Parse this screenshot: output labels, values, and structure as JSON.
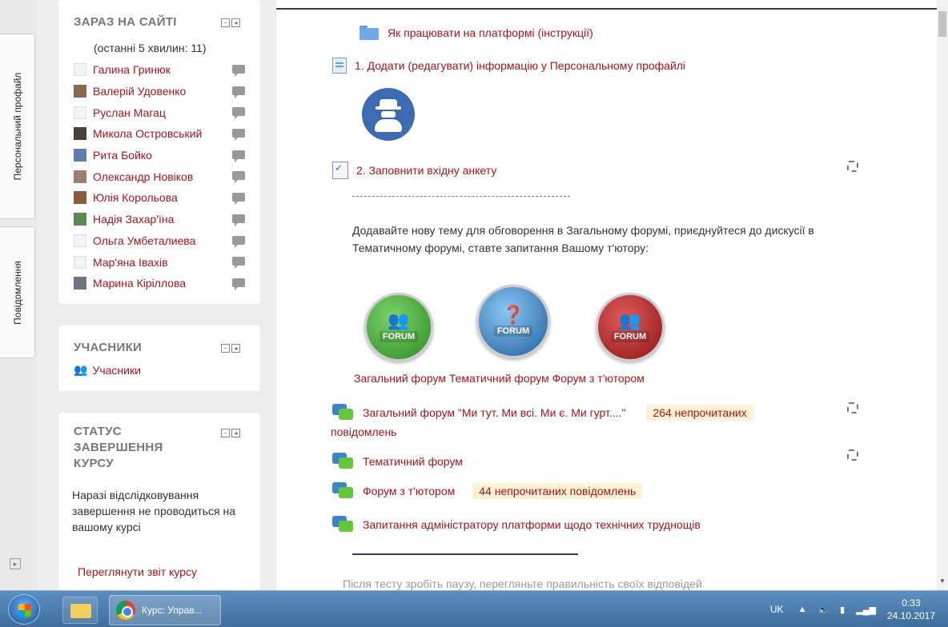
{
  "sidebar_tabs": {
    "profile": "Персональний профайл",
    "messages": "Повідомлення"
  },
  "online_block": {
    "title": "ЗАРАЗ НА САЙТІ",
    "subtitle": "(останні 5 хвилин: 11)",
    "users": [
      {
        "name": "Галина Гринюк",
        "has_photo": false
      },
      {
        "name": "Валерій Удовенко",
        "has_photo": true
      },
      {
        "name": "Руслан Магац",
        "has_photo": false
      },
      {
        "name": "Микола Островський",
        "has_photo": true
      },
      {
        "name": "Рита Бойко",
        "has_photo": true
      },
      {
        "name": "Олександр Новіков",
        "has_photo": true
      },
      {
        "name": "Юлія Корольова",
        "has_photo": true
      },
      {
        "name": "Надія Захар'їна",
        "has_photo": true
      },
      {
        "name": "Ольга Умбеталиева",
        "has_photo": false
      },
      {
        "name": "Мар'яна Івахів",
        "has_photo": false
      },
      {
        "name": "Марина Кіріллова",
        "has_photo": true
      }
    ]
  },
  "participants_block": {
    "title": "УЧАСНИКИ",
    "link": "Учасники"
  },
  "completion_block": {
    "title": "СТАТУС ЗАВЕРШЕННЯ КУРСУ",
    "text": "Наразі відслідковування завершення не проводиться на вашому курсі",
    "report_link": "Переглянути звіт курсу"
  },
  "main": {
    "instructions_folder": "Як працювати на платформі (інструкції)",
    "step1": "1. Додати (редагувати) інформацію у Персональному профайлі",
    "step2": "2. Заповнити вхідну анкету",
    "dashes": "--------------------------------------------------------",
    "paragraph": "Додавайте нову тему для обговорення в  Загальному форумі, приєднуйтеся до дискусії в Тематичному форумі, ставте запитання Вашому т'ютору:",
    "forum_badge_label": "FORUM",
    "forum_caption": "Загальний форум Тематичний форум Форум з т'ютором",
    "forums": [
      {
        "name": "Загальний форум \"Ми тут. Ми всі. Ми є. Ми гурт....\"",
        "badge": "264 непрочитаних",
        "cont": "повідомлень"
      },
      {
        "name": "Тематичний форум"
      },
      {
        "name": "Форум з т'ютором",
        "badge": "44 непрочитаних повідомлень"
      },
      {
        "name": "Запитання адміністратору платформи щодо технічних труднощів"
      }
    ],
    "bottom_text": "Після тесту зробіть паузу, перегляньте правильність своїх відповідей"
  },
  "taskbar": {
    "chrome_tab": "Курс: Управ...",
    "lang": "UK",
    "time": "0:33",
    "date": "24.10.2017"
  },
  "colors": {
    "link_red": "#a5141b",
    "taskbar": "#4a7aab",
    "badge_bg": "#fdf3d4"
  }
}
